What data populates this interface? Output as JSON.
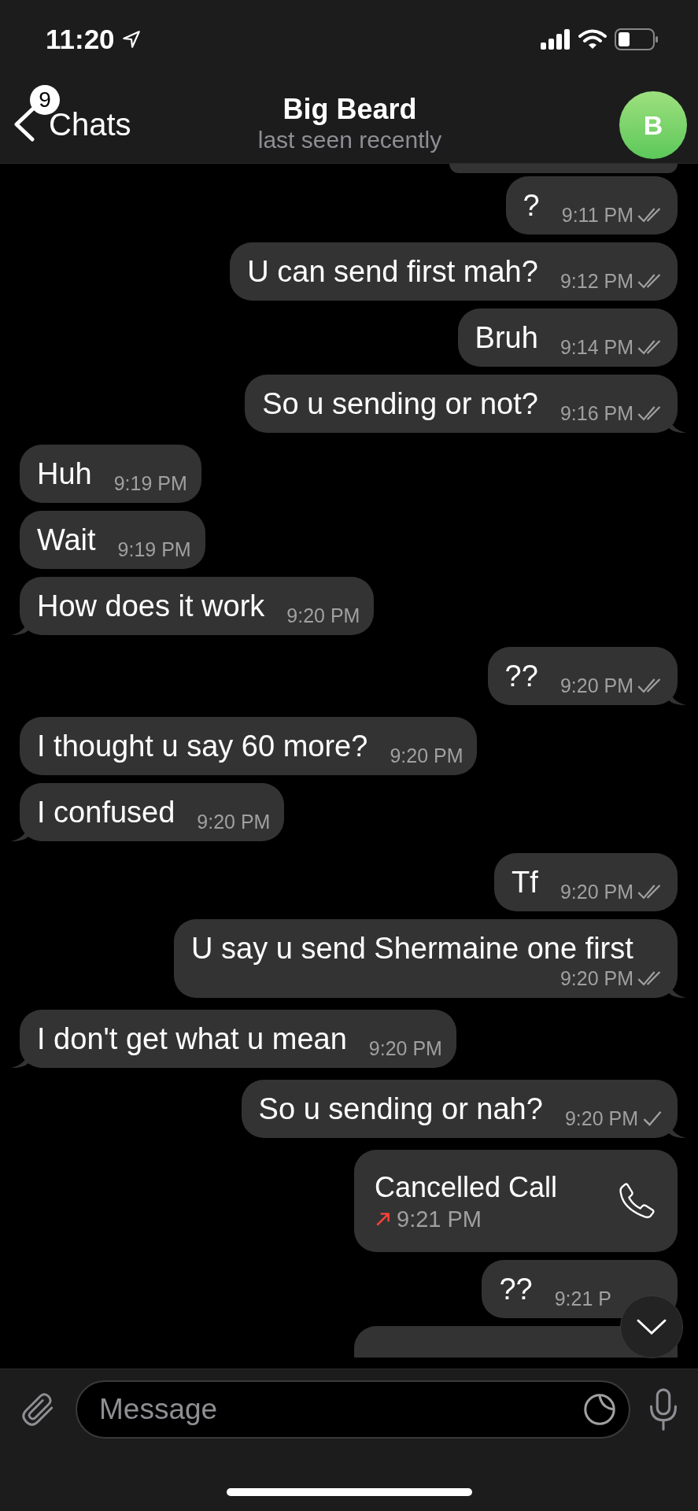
{
  "status_bar": {
    "time": "11:20"
  },
  "nav": {
    "back_label": "Chats",
    "unread_badge": "9",
    "title": "Big Beard",
    "subtitle": "last seen recently",
    "avatar_letter": "B"
  },
  "messages": [
    {
      "kind": "partial",
      "outgoing": true
    },
    {
      "kind": "text",
      "outgoing": true,
      "text": "?",
      "time": "9:11 PM",
      "read": true,
      "tail": false
    },
    {
      "kind": "text",
      "outgoing": true,
      "text": "U can send first mah?",
      "time": "9:12 PM",
      "read": true,
      "tail": false
    },
    {
      "kind": "text",
      "outgoing": true,
      "text": "Bruh",
      "time": "9:14 PM",
      "read": true,
      "tail": false
    },
    {
      "kind": "text",
      "outgoing": true,
      "text": "So u sending or not?",
      "time": "9:16 PM",
      "read": true,
      "tail": true
    },
    {
      "kind": "text",
      "outgoing": false,
      "text": "Huh",
      "time": "9:19 PM",
      "tail": false
    },
    {
      "kind": "text",
      "outgoing": false,
      "text": "Wait",
      "time": "9:19 PM",
      "tail": false
    },
    {
      "kind": "text",
      "outgoing": false,
      "text": "How does it work",
      "time": "9:20 PM",
      "tail": true
    },
    {
      "kind": "text",
      "outgoing": true,
      "text": "??",
      "time": "9:20 PM",
      "read": true,
      "tail": true
    },
    {
      "kind": "text",
      "outgoing": false,
      "text": "I thought u say 60 more?",
      "time": "9:20 PM",
      "tail": false
    },
    {
      "kind": "text",
      "outgoing": false,
      "text": "I confused",
      "time": "9:20 PM",
      "tail": true
    },
    {
      "kind": "text",
      "outgoing": true,
      "text": "Tf",
      "time": "9:20 PM",
      "read": true,
      "tail": false
    },
    {
      "kind": "text",
      "outgoing": true,
      "text": "U say u send Shermaine one first",
      "time": "9:20 PM",
      "read": true,
      "tail": true
    },
    {
      "kind": "text",
      "outgoing": false,
      "text": "I don't get what u mean",
      "time": "9:20 PM",
      "tail": true
    },
    {
      "kind": "text",
      "outgoing": true,
      "text": "So u sending or nah?",
      "time": "9:20 PM",
      "read": false,
      "tail": true
    },
    {
      "kind": "call",
      "outgoing": true,
      "title": "Cancelled Call",
      "time": "9:21 PM",
      "tail": false
    },
    {
      "kind": "text",
      "outgoing": true,
      "text": "??",
      "time": "9:21 P",
      "tail": false
    },
    {
      "kind": "partial",
      "outgoing": true
    }
  ],
  "composer": {
    "placeholder": "Message"
  }
}
